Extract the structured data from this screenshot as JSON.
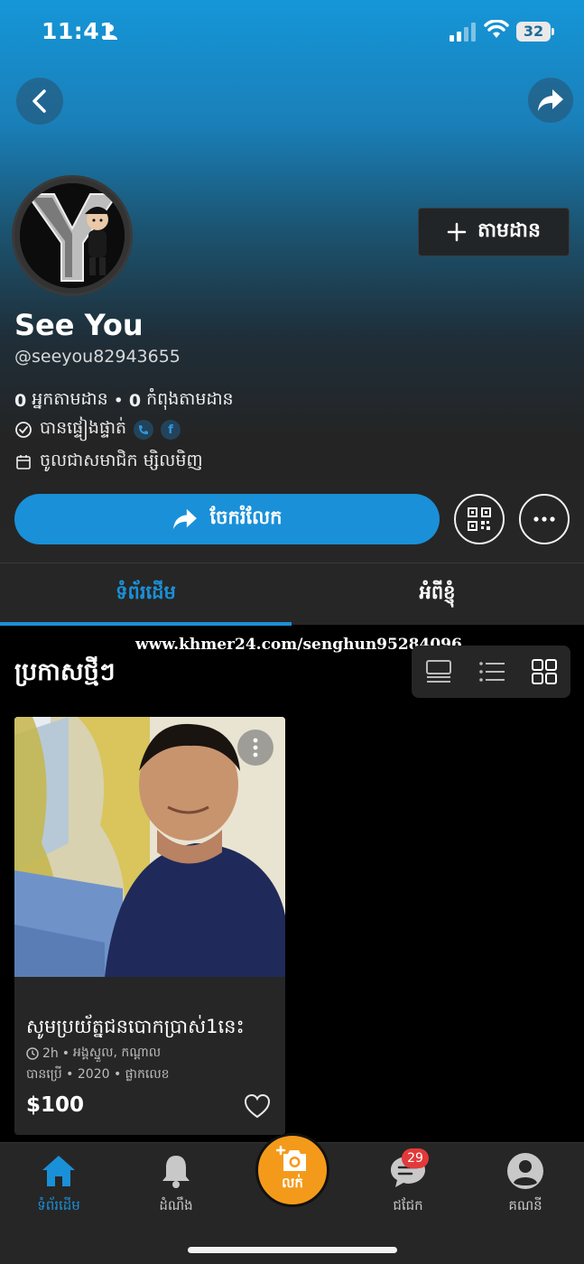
{
  "status_bar": {
    "time": "11:41",
    "battery": "32"
  },
  "header": {
    "back_icon": "chevron-left-icon",
    "share_icon": "share-arrow-icon"
  },
  "profile": {
    "name": "See You",
    "handle": "@seeyou82943655",
    "follow_label": "តាមដាន",
    "followers_count": "0",
    "followers_label": "អ្នកតាមដាន",
    "following_count": "0",
    "following_label": "កំពុងតាមដាន",
    "verified_label": "បានផ្ទៀងផ្ទាត់",
    "member_label": "ចូលជាសមាជិក ម្សិលមិញ",
    "share_label": "ចែករំលែក"
  },
  "tabs": [
    {
      "label": "ទំព័រដើម",
      "active": true
    },
    {
      "label": "អំពីខ្ញុំ",
      "active": false
    }
  ],
  "watermark": "www.khmer24.com/senghun95284096",
  "section": {
    "title": "ប្រកាសថ្មីៗ"
  },
  "listing": {
    "title": "សូមប្រយ័ត្នជនបោកប្រាស់1នេះ",
    "time": "2h",
    "location": "អង្គស្នួល, កណ្ដាល",
    "condition": "បានប្រើ • 2020 • ផ្លាកលេខ",
    "price": "$100"
  },
  "bottom_nav": {
    "home": "ទំព័រដើម",
    "notifications": "ដំណឹង",
    "sell": "លក់",
    "chat": "ជជែក",
    "chat_badge": "29",
    "account": "គណនី"
  },
  "colors": {
    "accent": "#1a90d8",
    "sell": "#f49a1a",
    "badge": "#e23a3a",
    "surface": "#262626"
  }
}
